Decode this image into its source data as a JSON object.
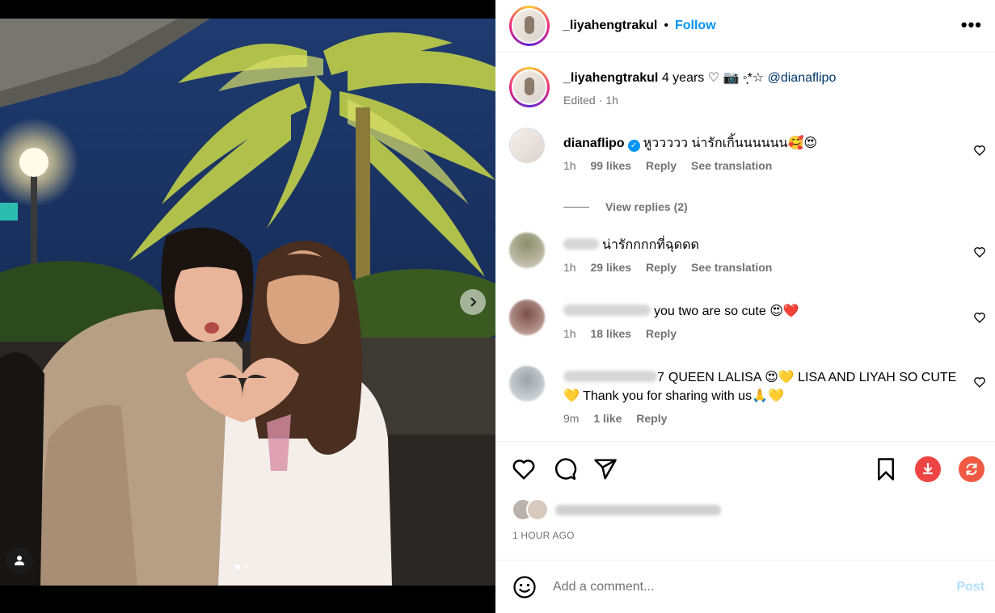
{
  "post": {
    "username": "_liyahengtrakul",
    "follow_label": "Follow",
    "more_label": "•••",
    "dot": "•",
    "caption": {
      "username": "_liyahengtrakul",
      "text_before": "4 years ♡ 📷 ◦͙*☆",
      "mention": "@dianaflipo",
      "edited": "Edited",
      "dot": "·",
      "time": "1h"
    },
    "comments": [
      {
        "username": "dianaflipo",
        "verified": true,
        "text": "หูววววว น่ารักเกิ้นนนนนน🥰😍",
        "time": "1h",
        "likes": "99 likes",
        "reply": "Reply",
        "translate": "See translation",
        "view_replies": "View replies (2)"
      },
      {
        "username": "",
        "text": "น่ารักกกกที่ฉุดดด",
        "time": "1h",
        "likes": "29 likes",
        "reply": "Reply",
        "translate": "See translation"
      },
      {
        "username": "",
        "text": "you two are so cute 😍❤️",
        "time": "1h",
        "likes": "18 likes",
        "reply": "Reply"
      },
      {
        "username_tail": "7",
        "text": "QUEEN LALISA 😍💛 LISA AND LIYAH SO CUTE 💛 Thank you for sharing with us🙏💛",
        "time": "9m",
        "likes": "1 like",
        "reply": "Reply"
      }
    ],
    "posted_time": "1 HOUR AGO",
    "add_comment_placeholder": "Add a comment...",
    "post_label": "Post"
  },
  "colors": {
    "accent": "#0095f6",
    "post_disabled": "#b2dffc",
    "download": "#ef4444",
    "refresh": "#f05a43"
  },
  "icons": [
    "heart-icon",
    "comment-icon",
    "share-icon",
    "bookmark-icon",
    "download-icon",
    "refresh-icon",
    "emoji-icon",
    "chevron-right-icon",
    "user-tag-icon"
  ]
}
